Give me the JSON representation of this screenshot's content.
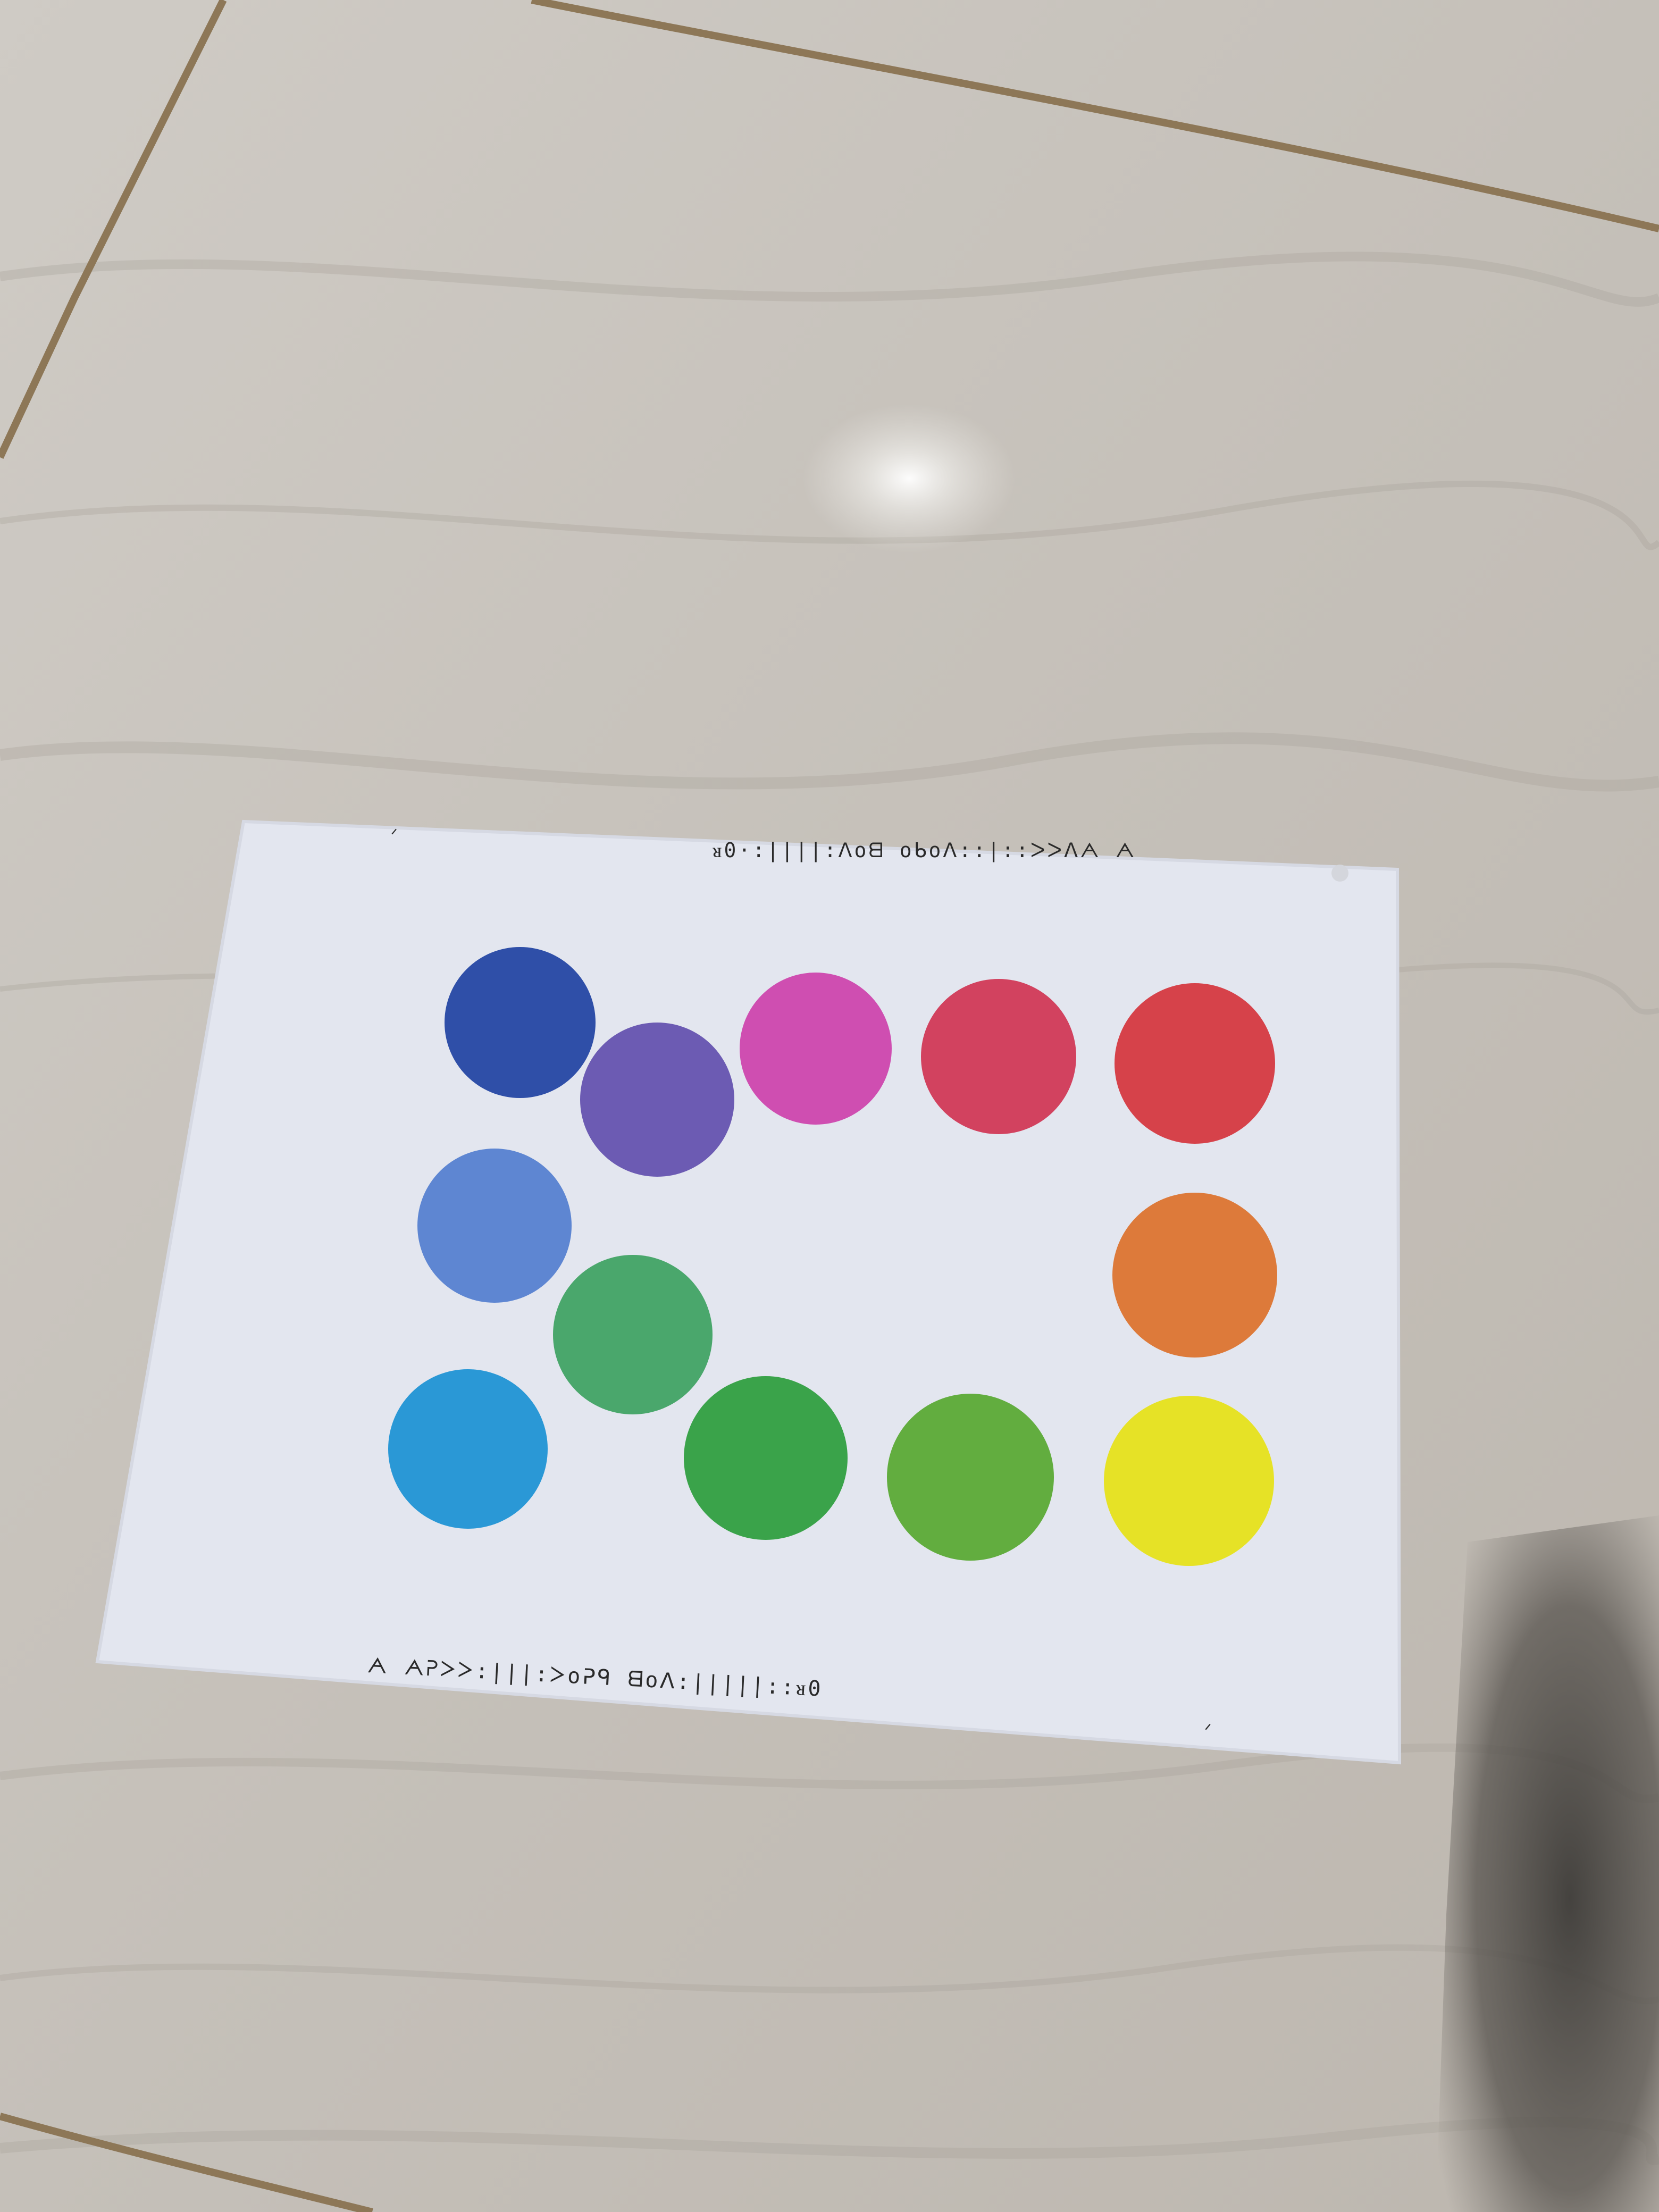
{
  "scene": {
    "floor_base_color": "#c8c4be",
    "floor_vein_color": "#a9a39b",
    "grout_color": "#8a7458",
    "highlight_color": "#f6f6f4",
    "shadow_color": "#2f2d2b"
  },
  "card": {
    "paper_color": "#e3e6ef",
    "paper_edge_color": "#d6d9e3",
    "print_color": "#2a2a2a",
    "top_markings": "ᴚ0·:||||:ᐱoᗺ oᑲoᐱ::|::ᐳᐳᐱᗅ ᗅ",
    "bottom_markings": "ᗅ ᗅᕈᐳᐳ:|||:ᐳoᕈᑫ ᗺoᐱ:|||||::ᴚ0",
    "corner_mark_top_left": "ᐟ",
    "corner_mark_bottom_right": "ᐟ",
    "dot_color_top_right_corner": "#d4d6dc"
  },
  "swatches": [
    {
      "name": "dark-blue",
      "color": "#2f4fa8"
    },
    {
      "name": "violet",
      "color": "#6c5bb3"
    },
    {
      "name": "magenta",
      "color": "#cf4eb1"
    },
    {
      "name": "crimson",
      "color": "#d2425f"
    },
    {
      "name": "red",
      "color": "#d6424a"
    },
    {
      "name": "periwinkle",
      "color": "#5e86d2"
    },
    {
      "name": "orange",
      "color": "#dd7a3a"
    },
    {
      "name": "sea-green",
      "color": "#4aa76c"
    },
    {
      "name": "sky-blue",
      "color": "#2a98d6"
    },
    {
      "name": "green",
      "color": "#3aa34a"
    },
    {
      "name": "lime-green",
      "color": "#62ad3f"
    },
    {
      "name": "yellow",
      "color": "#e6e226"
    }
  ]
}
